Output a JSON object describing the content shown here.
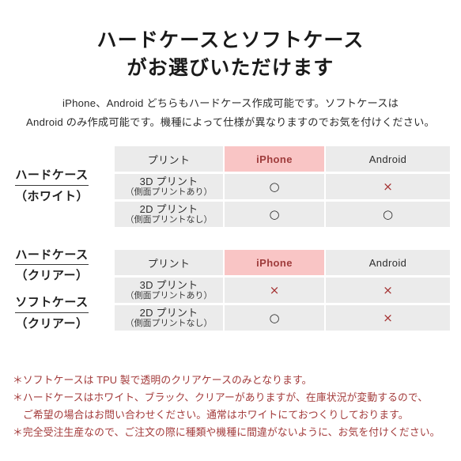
{
  "title": {
    "line1": "ハードケースとソフトケース",
    "line2": "がお選びいただけます"
  },
  "description": {
    "line1": "iPhone、Android どちらもハードケース作成可能です。ソフトケースは",
    "line2": "Android のみ作成可能です。機種によって仕様が異なりますのでお気を付けください。"
  },
  "colors": {
    "pink_cell": "#fdcccc",
    "pink_header": "#f9c5c5",
    "gray_cell": "#ebebeb",
    "accent_red": "#a33b3b",
    "text_dark": "#231f20"
  },
  "tables": [
    {
      "labels": [
        {
          "main": "ハードケース",
          "sub": "（ホワイト）"
        }
      ],
      "headers": [
        "プリント",
        "iPhone",
        "Android"
      ],
      "rows": [
        {
          "label_line1": "3D プリント",
          "label_line2": "（側面プリントあり）",
          "iphone": "○",
          "android": "×"
        },
        {
          "label_line1": "2D プリント",
          "label_line2": "（側面プリントなし）",
          "iphone": "○",
          "android": "○"
        }
      ]
    },
    {
      "labels": [
        {
          "main": "ハードケース",
          "sub": "（クリアー）"
        },
        {
          "main": "ソフトケース",
          "sub": "（クリアー）"
        }
      ],
      "headers": [
        "プリント",
        "iPhone",
        "Android"
      ],
      "rows": [
        {
          "label_line1": "3D プリント",
          "label_line2": "（側面プリントあり）",
          "iphone": "×",
          "android": "×"
        },
        {
          "label_line1": "2D プリント",
          "label_line2": "（側面プリントなし）",
          "iphone": "○",
          "android": "×"
        }
      ]
    }
  ],
  "notes": {
    "line1": "＊ソフトケースは TPU 製で透明のクリアケースのみとなります。",
    "line2": "＊ハードケースはホワイト、ブラック、クリアーがありますが、在庫状況が変動するので、",
    "line3": "ご希望の場合はお問い合わせください。通常はホワイトにておつくりしております。",
    "line4": "＊完全受注生産なので、ご注文の際に種類や機種に間違がないように、お気を付けください。"
  }
}
